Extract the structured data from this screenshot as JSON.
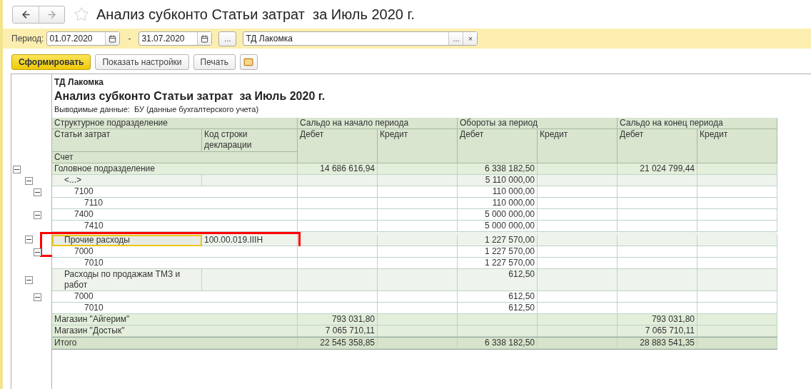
{
  "window": {
    "title": "Анализ субконто Статьи затрат  за Июль 2020 г."
  },
  "filter": {
    "period_label": "Период:",
    "date_from": "01.07.2020",
    "separator": "-",
    "date_to": "31.07.2020",
    "more_button": "...",
    "organization": "ТД Лакомка",
    "organization_select": "...",
    "clear_button": "×"
  },
  "toolbar": [
    {
      "label": "Сформировать",
      "kind": "primary"
    },
    {
      "label": "Показать настройки",
      "kind": "default"
    },
    {
      "label": "Печать",
      "kind": "default"
    },
    {
      "kind": "mail"
    }
  ],
  "report": {
    "company": "ТД Лакомка",
    "title": "Анализ субконто Статьи затрат  за Июль 2020 г.",
    "output": "Выводимые данные:  БУ (данные бухгалтерского учета)",
    "header": {
      "group_columns": [
        "Структурное подразделение",
        "Сальдо на начало периода",
        "Обороты за период",
        "Сальдо на конец периода"
      ],
      "article_column": "Статьи затрат",
      "code_column": "Код строки декларации",
      "amount_columns": [
        "Дебет",
        "Кредит",
        "Дебет",
        "Кредит",
        "Дебет",
        "Кредит"
      ],
      "account_column": "Счет"
    },
    "rows": [
      {
        "kind": "department",
        "name": "Головное подразделение",
        "expanded": true,
        "selected": false,
        "start_debit": "14 686 616,94",
        "turnover_debit": "6 338 182,50",
        "end_debit": "21 024 799,44",
        "children": [
          {
            "kind": "article",
            "name": "<...>",
            "expanded": true,
            "selected": false,
            "turnover_debit": "5 110 000,00",
            "children": [
              {
                "kind": "account",
                "name": "7100",
                "expanded": true,
                "selected": false,
                "turnover_debit": "110 000,00",
                "children": [
                  {
                    "kind": "account",
                    "name": "7110",
                    "selected": false,
                    "turnover_debit": "110 000,00"
                  }
                ]
              },
              {
                "kind": "account",
                "name": "7400",
                "expanded": true,
                "selected": false,
                "turnover_debit": "5 000 000,00",
                "children": [
                  {
                    "kind": "account",
                    "name": "7410",
                    "selected": false,
                    "turnover_debit": "5 000 000,00"
                  }
                ]
              }
            ]
          },
          {
            "kind": "article",
            "name": "Прочие расходы",
            "code": "100.00.019.IIIH",
            "expanded": true,
            "selected": true,
            "marked": true,
            "turnover_debit": "1 227 570,00",
            "children": [
              {
                "kind": "account",
                "name": "7000",
                "expanded": true,
                "selected": false,
                "turnover_debit": "1 227 570,00",
                "children": [
                  {
                    "kind": "account",
                    "name": "7010",
                    "selected": false,
                    "turnover_debit": "1 227 570,00"
                  }
                ]
              }
            ]
          },
          {
            "kind": "article",
            "name": "Расходы по продажам ТМЗ и работ",
            "expanded": true,
            "selected": false,
            "turnover_debit": "612,50",
            "children": [
              {
                "kind": "account",
                "name": "7000",
                "expanded": true,
                "selected": false,
                "turnover_debit": "612,50",
                "children": [
                  {
                    "kind": "account",
                    "name": "7010",
                    "selected": false,
                    "turnover_debit": "612,50"
                  }
                ]
              }
            ]
          }
        ]
      },
      {
        "kind": "department",
        "name": "Магазин \"Айгерим\"",
        "selected": false,
        "start_debit": "793 031,80",
        "end_debit": "793 031,80"
      },
      {
        "kind": "department",
        "name": "Магазин \"Достык\"",
        "selected": false,
        "start_debit": "7 065 710,11",
        "end_debit": "7 065 710,11"
      },
      {
        "kind": "total",
        "name": "Итого",
        "selected": false,
        "start_debit": "22 545 358,85",
        "turnover_debit": "6 338 182,50",
        "end_debit": "28 883 541,35"
      }
    ]
  }
}
